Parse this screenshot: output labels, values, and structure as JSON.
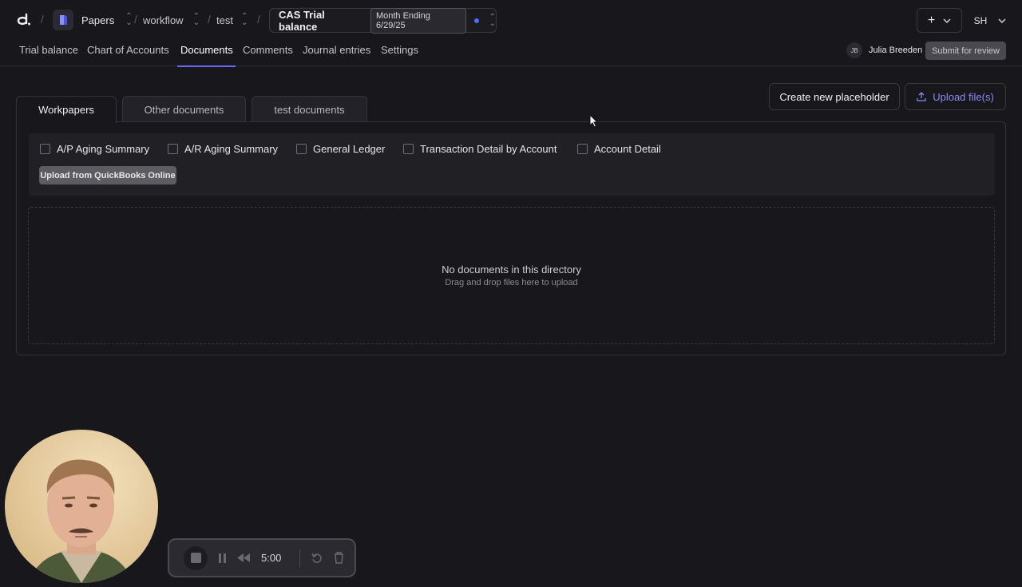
{
  "breadcrumb": {
    "workspace": "Papers",
    "folder": "workflow",
    "project": "test",
    "document_title": "CAS Trial balance",
    "period": "Month Ending 6/29/25"
  },
  "user": {
    "initials": "SH"
  },
  "nav": {
    "tabs": [
      "Trial balance",
      "Chart of Accounts",
      "Documents",
      "Comments",
      "Journal entries",
      "Settings"
    ],
    "active": "Documents"
  },
  "reviewer": {
    "initials": "JB",
    "name": "Julia Breeden"
  },
  "submit_label": "Submit for review",
  "actions": {
    "create_placeholder": "Create new placeholder",
    "upload_files": "Upload file(s)"
  },
  "doc_tabs": [
    "Workpapers",
    "Other documents",
    "test documents"
  ],
  "quickbooks": {
    "reports": [
      "A/P Aging Summary",
      "A/R Aging Summary",
      "General Ledger",
      "Transaction Detail by Account",
      "Account Detail"
    ],
    "upload_label": "Upload from QuickBooks Online"
  },
  "dropzone": {
    "title": "No documents in this directory",
    "subtitle": "Drag and drop files here to upload"
  },
  "recorder": {
    "time": "5:00"
  },
  "colors": {
    "accent": "#6b6af0",
    "status_dot": "#4f6ef7",
    "background": "#18171b"
  }
}
